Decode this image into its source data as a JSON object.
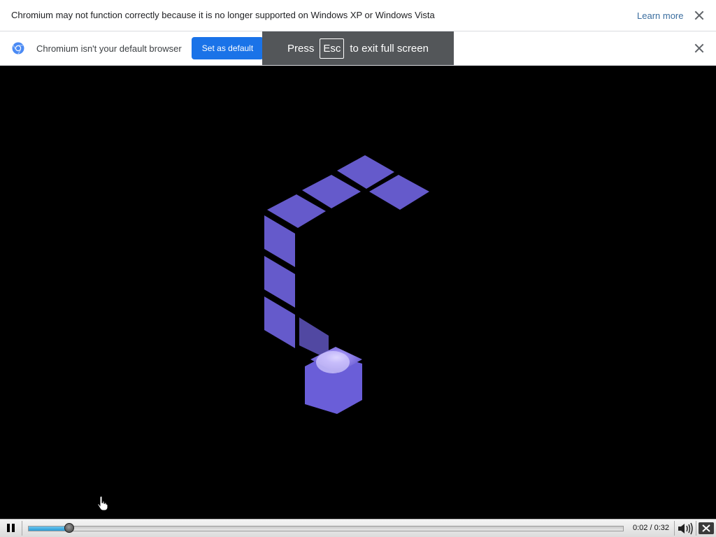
{
  "infobar_unsupported": {
    "message": "Chromium may not function correctly because it is no longer supported on Windows XP or Windows Vista",
    "learn_more": "Learn more",
    "close_icon": "close-icon"
  },
  "infobar_default_browser": {
    "icon": "chromium-icon",
    "message": "Chromium isn't your default browser",
    "button_label": "Set as default",
    "close_icon": "close-icon"
  },
  "fullscreen_toast": {
    "prefix": "Press",
    "key": "Esc",
    "suffix": "to exit full screen"
  },
  "player": {
    "play_state_icon": "pause-icon",
    "progress_fraction": 0.0688,
    "time_display": "0:02 / 0:32",
    "volume_icon": "volume-icon",
    "fullscreen_icon": "exit-fullscreen-icon"
  },
  "colors": {
    "accent": "#1a73e8",
    "toast_bg": "#535659",
    "video_cube": "#6b5fd6"
  }
}
